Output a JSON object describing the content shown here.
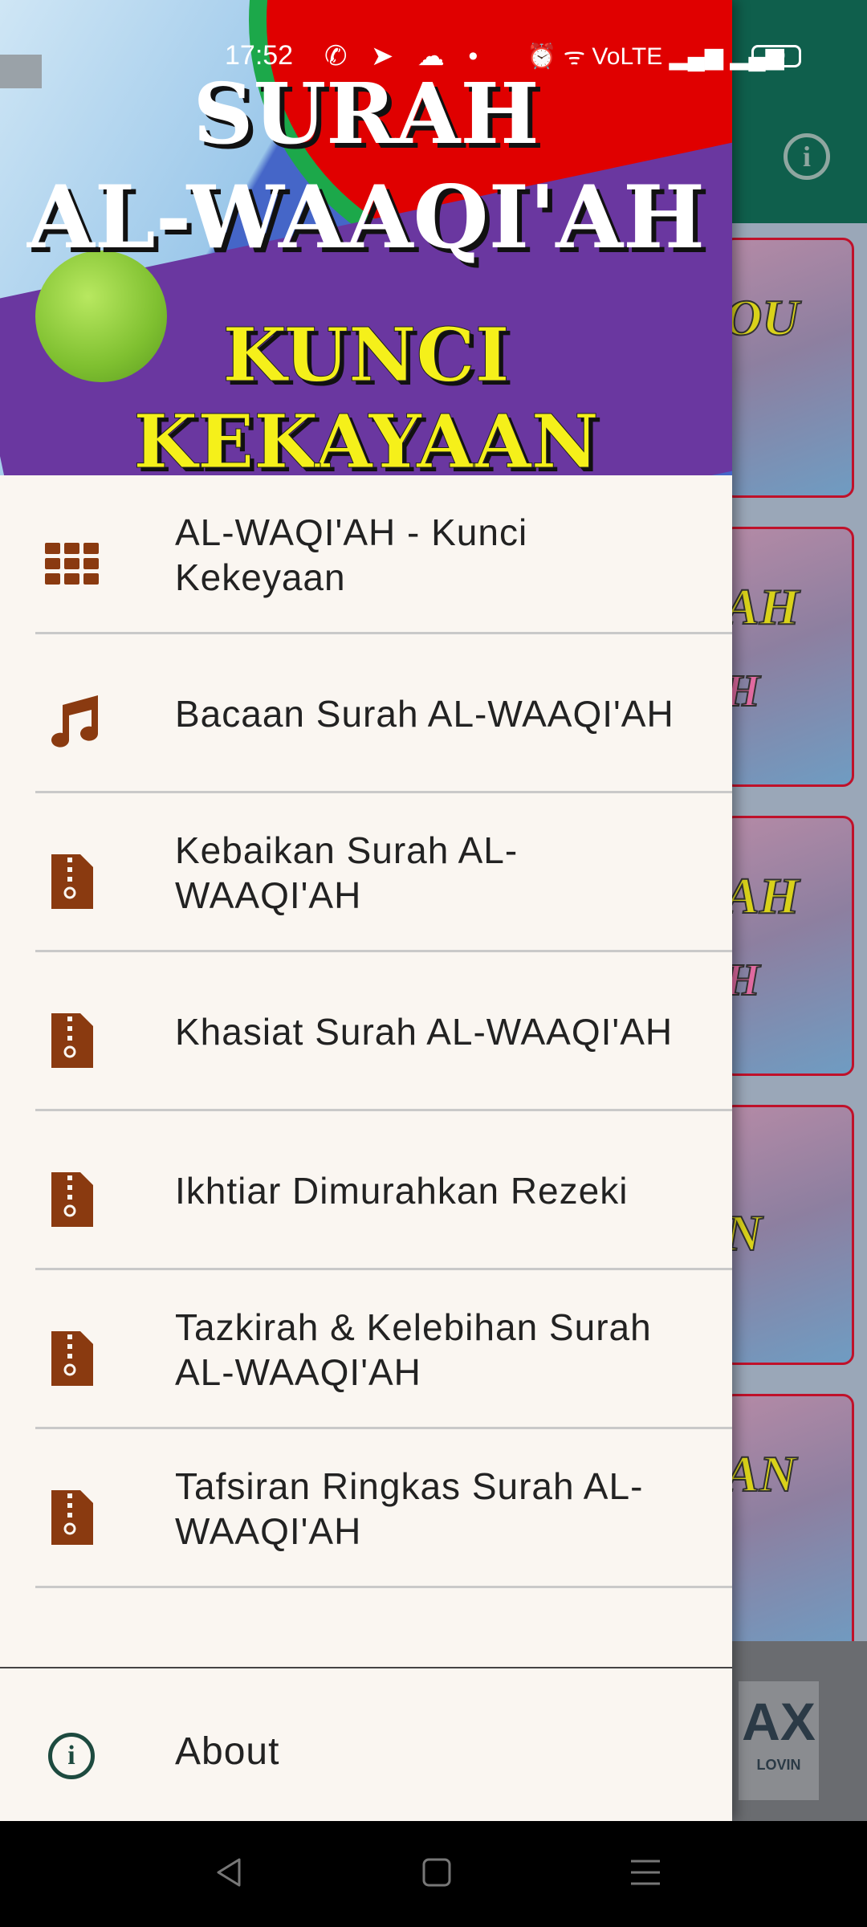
{
  "status_bar": {
    "time": "17:52",
    "app_icons": "✆ ➤ ☁ •",
    "right_icons": "⏰ ᯤ VoLTE ▂▄▆ ▂▄▆",
    "battery": "80"
  },
  "banner": {
    "line1": "SURAH",
    "line2": "AL-WAAQI'AH",
    "line3": "KUNCI KEKAYAAN"
  },
  "menu": {
    "items": [
      {
        "label": "AL-WAQI'AH - Kunci Kekeyaan",
        "icon": "grid-icon"
      },
      {
        "label": "Bacaan Surah AL-WAAQI'AH",
        "icon": "music-note-icon"
      },
      {
        "label": "Kebaikan Surah AL-WAAQI'AH",
        "icon": "zip-file-icon"
      },
      {
        "label": "Khasiat Surah AL-WAAQI'AH",
        "icon": "zip-file-icon"
      },
      {
        "label": "Ikhtiar Dimurahkan Rezeki",
        "icon": "zip-file-icon"
      },
      {
        "label": "Tazkirah & Kelebihan Surah AL-WAAQI'AH",
        "icon": "zip-file-icon"
      },
      {
        "label": "Tafsiran Ringkas Surah AL-WAAQI'AH",
        "icon": "zip-file-icon"
      }
    ]
  },
  "about": {
    "label": "About",
    "icon": "info-icon"
  },
  "background": {
    "info_icon": "i",
    "card_texts": [
      "OU",
      "AH",
      "H",
      "AH",
      "H",
      "N",
      "AN"
    ],
    "ad_text": "AX",
    "ad_sub": "LOVIN"
  },
  "colors": {
    "drawer_bg": "#faf6f1",
    "icon_brown": "#8a3a10",
    "toolbar_green": "#0f5f4c",
    "banner_yellow": "#f5f01a"
  }
}
